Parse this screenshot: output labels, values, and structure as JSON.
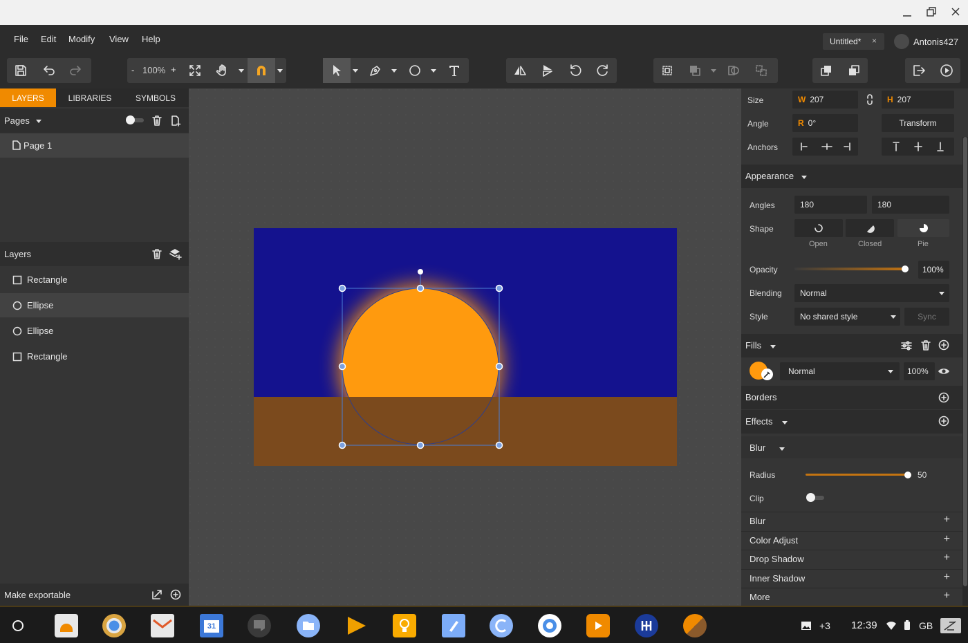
{
  "window_controls": {
    "minimize": "—",
    "maximize": "❐",
    "close": "✕"
  },
  "menu": [
    "File",
    "Edit",
    "Modify",
    "View",
    "Help"
  ],
  "doc_tab": {
    "title": "Untitled*",
    "close": "×"
  },
  "user": {
    "name": "Antonis427"
  },
  "zoom": {
    "minus": "-",
    "value": "100%",
    "plus": "+"
  },
  "left_tabs": [
    "LAYERS",
    "LIBRARIES",
    "SYMBOLS"
  ],
  "pages": {
    "title": "Pages",
    "items": [
      "Page 1"
    ]
  },
  "layers": {
    "title": "Layers",
    "items": [
      {
        "name": "Rectangle",
        "icon": "rectangle-icon"
      },
      {
        "name": "Ellipse",
        "icon": "ellipse-icon"
      },
      {
        "name": "Ellipse",
        "icon": "ellipse-icon"
      },
      {
        "name": "Rectangle",
        "icon": "rectangle-icon"
      }
    ],
    "selected_index": 1
  },
  "make_exportable": "Make exportable",
  "inspector": {
    "size_label": "Size",
    "w_prefix": "W",
    "w_value": "207",
    "h_prefix": "H",
    "h_value": "207",
    "angle_label": "Angle",
    "r_prefix": "R",
    "angle_value": "0°",
    "transform_label": "Transform",
    "anchors_label": "Anchors",
    "appearance_title": "Appearance",
    "angles_label": "Angles",
    "angle_start": "180",
    "angle_end": "180",
    "shape_label": "Shape",
    "shape_options": [
      "Open",
      "Closed",
      "Pie"
    ],
    "opacity_label": "Opacity",
    "opacity_value": "100%",
    "opacity_fraction": 1.0,
    "blending_label": "Blending",
    "blending_value": "Normal",
    "style_label": "Style",
    "style_value": "No shared style",
    "sync_label": "Sync",
    "fills_title": "Fills",
    "fill_color": "#ff9a0e",
    "fill_blend": "Normal",
    "fill_opacity": "100%",
    "borders_title": "Borders",
    "effects_title": "Effects",
    "blur_title": "Blur",
    "radius_label": "Radius",
    "radius_value": "50",
    "radius_fraction": 1.0,
    "clip_label": "Clip",
    "clip_on": false,
    "effect_list": [
      "Blur",
      "Color Adjust",
      "Drop Shadow",
      "Inner Shadow",
      "More"
    ]
  },
  "artwork": {
    "sky_color": "#14128e",
    "ground_color": "#7b4a1d",
    "sun_color": "#ff9a0e",
    "accent": "#f08a00"
  },
  "taskbar": {
    "badge": "+3",
    "time": "12:39",
    "locale": "GB"
  }
}
